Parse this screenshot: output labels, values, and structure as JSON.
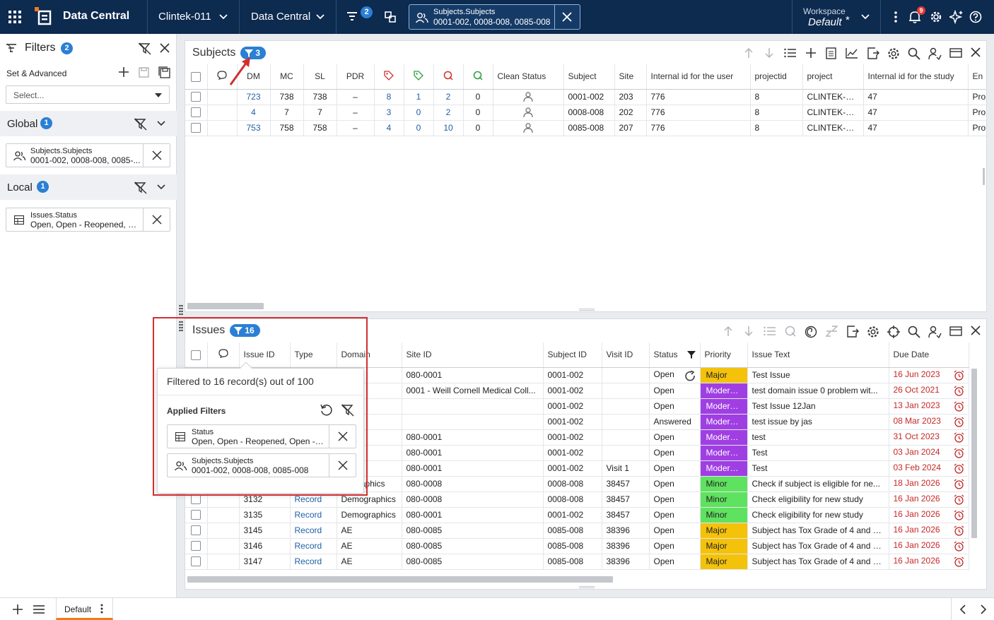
{
  "topbar": {
    "app_title": "Data Central",
    "study_selector": "Clintek-011",
    "module_selector": "Data Central",
    "filter_count": "2",
    "active_filter": {
      "title": "Subjects.Subjects",
      "value": "0001-002, 0008-008, 0085-008"
    },
    "workspace_label": "Workspace",
    "workspace_value": "Default",
    "workspace_modified": "*",
    "notification_count": "9",
    "icons": [
      "apps-grid-icon",
      "logo-icon",
      "filter-list-icon",
      "sync-icon",
      "users-icon",
      "close-icon",
      "more-vert-icon",
      "bell-icon",
      "gear-icon",
      "sparkle-icon",
      "help-icon"
    ]
  },
  "filters_panel": {
    "title": "Filters",
    "count": "2",
    "set_label": "Set & Advanced",
    "select_placeholder": "Select...",
    "global": {
      "label": "Global",
      "count": "1",
      "chip": {
        "title": "Subjects.Subjects",
        "value": "0001-002, 0008-008, 0085-..."
      }
    },
    "local": {
      "label": "Local",
      "count": "1",
      "chip": {
        "title": "Issues.Status",
        "value": "Open, Open - Reopened, Op..."
      }
    }
  },
  "subjects_panel": {
    "title": "Subjects",
    "filter_count": "3",
    "columns": [
      "DM",
      "MC",
      "SL",
      "PDR",
      "",
      "",
      "",
      "",
      "Clean Status",
      "Subject",
      "Site",
      "Internal id for the user",
      "projectid",
      "project",
      "Internal id for the study",
      "En"
    ],
    "rows": [
      {
        "dm": "723",
        "mc": "738",
        "sl": "738",
        "pdr": "–",
        "t1": "8",
        "t2": "1",
        "q1": "2",
        "q2": "0",
        "subject": "0001-002",
        "site": "203",
        "uid": "776",
        "projectid": "8",
        "project": "CLINTEK-011",
        "sid": "47",
        "en": "Pro"
      },
      {
        "dm": "4",
        "mc": "7",
        "sl": "7",
        "pdr": "–",
        "t1": "3",
        "t2": "0",
        "q1": "2",
        "q2": "0",
        "subject": "0008-008",
        "site": "202",
        "uid": "776",
        "projectid": "8",
        "project": "CLINTEK-011",
        "sid": "47",
        "en": "Pro"
      },
      {
        "dm": "753",
        "mc": "758",
        "sl": "758",
        "pdr": "–",
        "t1": "4",
        "t2": "0",
        "q1": "10",
        "q2": "0",
        "subject": "0085-008",
        "site": "207",
        "uid": "776",
        "projectid": "8",
        "project": "CLINTEK-011",
        "sid": "47",
        "en": "Pro"
      }
    ]
  },
  "issues_panel": {
    "title": "Issues",
    "filter_count": "16",
    "columns": [
      "Issue ID",
      "Type",
      "Domain",
      "Site ID",
      "Subject ID",
      "Visit ID",
      "Status",
      "Priority",
      "Issue Text",
      "Due Date"
    ],
    "rows": [
      {
        "id": "",
        "type": "",
        "domain": "",
        "site": "080-0001",
        "subject": "0001-002",
        "visit": "",
        "status": "Open",
        "priority": "Major",
        "text": "Test Issue",
        "due": "16 Jun 2023"
      },
      {
        "id": "",
        "type": "",
        "domain": "",
        "site": "0001 - Weill Cornell Medical Coll...",
        "subject": "0001-002",
        "visit": "",
        "status": "Open",
        "priority": "Moderate",
        "text": "test domain issue 0 problem wit...",
        "due": "26 Oct 2021"
      },
      {
        "id": "",
        "type": "",
        "domain": "",
        "site": "",
        "subject": "0001-002",
        "visit": "",
        "status": "Open",
        "priority": "Moderate",
        "text": "Test Issue 12Jan",
        "due": "13 Jan 2023"
      },
      {
        "id": "",
        "type": "",
        "domain": "",
        "site": "",
        "subject": "0001-002",
        "visit": "",
        "status": "Answered",
        "priority": "Moderate",
        "text": "test issue by jas",
        "due": "08 Mar 2023"
      },
      {
        "id": "",
        "type": "",
        "domain": "",
        "site": "080-0001",
        "subject": "0001-002",
        "visit": "",
        "status": "Open",
        "priority": "Moderate",
        "text": "test",
        "due": "31 Oct 2023"
      },
      {
        "id": "",
        "type": "",
        "domain": "",
        "site": "080-0001",
        "subject": "0001-002",
        "visit": "",
        "status": "Open",
        "priority": "Moderate",
        "text": "Test",
        "due": "03 Jan 2024"
      },
      {
        "id": "",
        "type": "",
        "domain": "",
        "site": "080-0001",
        "subject": "0001-002",
        "visit": "Visit 1",
        "status": "Open",
        "priority": "Moderate",
        "text": "Test",
        "due": "03 Feb 2024"
      },
      {
        "id": "",
        "type": "",
        "domain": "mographics",
        "site": "080-0008",
        "subject": "0008-008",
        "visit": "38457",
        "status": "Open",
        "priority": "Minor",
        "text": "Check if subject is eligible for ne...",
        "due": "18 Jan 2026"
      },
      {
        "id": "3132",
        "type": "Record",
        "domain": "Demographics",
        "site": "080-0008",
        "subject": "0008-008",
        "visit": "38457",
        "status": "Open",
        "priority": "Minor",
        "text": "Check eligibility for new study",
        "due": "16 Jan 2026"
      },
      {
        "id": "3135",
        "type": "Record",
        "domain": "Demographics",
        "site": "080-0001",
        "subject": "0001-002",
        "visit": "38457",
        "status": "Open",
        "priority": "Minor",
        "text": "Check eligibility for new study",
        "due": "16 Jan 2026"
      },
      {
        "id": "3145",
        "type": "Record",
        "domain": "AE",
        "site": "080-0085",
        "subject": "0085-008",
        "visit": "38396",
        "status": "Open",
        "priority": "Major",
        "text": "Subject has Tox Grade of 4 and S...",
        "due": "16 Jan 2026"
      },
      {
        "id": "3146",
        "type": "Record",
        "domain": "AE",
        "site": "080-0085",
        "subject": "0085-008",
        "visit": "38396",
        "status": "Open",
        "priority": "Major",
        "text": "Subject has Tox Grade of 4 and S...",
        "due": "16 Jan 2026"
      },
      {
        "id": "3147",
        "type": "Record",
        "domain": "AE",
        "site": "080-0085",
        "subject": "0085-008",
        "visit": "38396",
        "status": "Open",
        "priority": "Major",
        "text": "Subject has Tox Grade of 4 and S...",
        "due": "16 Jan 2026"
      }
    ]
  },
  "popup": {
    "summary": "Filtered to 16 record(s) out of 100",
    "applied_label": "Applied Filters",
    "chips": [
      {
        "title": "Status",
        "value": "Open, Open - Reopened, Open - P..."
      },
      {
        "title": "Subjects.Subjects",
        "value": "0001-002, 0008-008, 0085-008"
      }
    ]
  },
  "bottombar": {
    "tab_label": "Default"
  },
  "colors": {
    "topbar": "#0d2a4f",
    "accent": "#2b7fd4",
    "major": "#f5c20b",
    "moderate": "#9f3fe3",
    "minor": "#5fe25f",
    "annotation": "#d32f2f"
  }
}
